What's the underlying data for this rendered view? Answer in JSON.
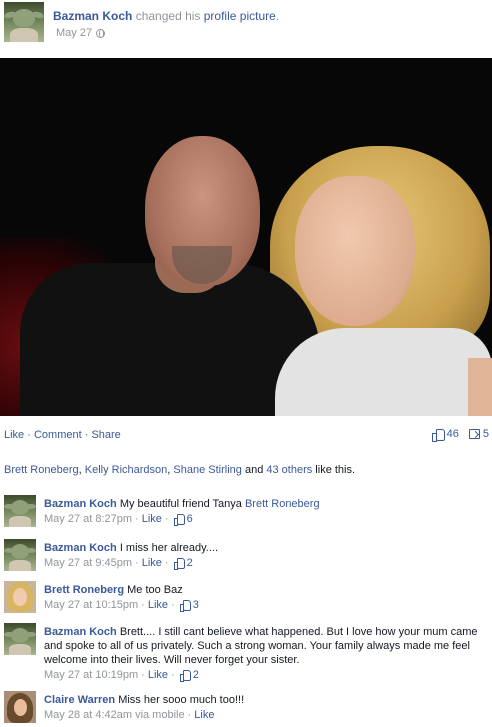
{
  "post": {
    "author": "Bazman Koch",
    "action_pre": " changed his ",
    "action_link": "profile picture",
    "action_post": ".",
    "date": "May 27"
  },
  "actions": {
    "like": "Like",
    "comment": "Comment",
    "share": "Share",
    "sep": " · ",
    "like_count": "46",
    "share_count": "5"
  },
  "likes": {
    "names": [
      "Brett Roneberg",
      "Kelly Richardson",
      "Shane Stirling"
    ],
    "sep1": ", ",
    "and": " and ",
    "others": "43 others",
    "suffix": " like this."
  },
  "comments": [
    {
      "name": "Bazman Koch",
      "text": "My beautiful friend Tanya ",
      "tag": "Brett Roneberg",
      "time": "May 27 at 8:27pm",
      "via": "",
      "like": "Like",
      "likes": "6"
    },
    {
      "name": "Bazman Koch",
      "text": "I miss her already....",
      "tag": "",
      "time": "May 27 at 9:45pm",
      "via": "",
      "like": "Like",
      "likes": "2"
    },
    {
      "name": "Brett Roneberg",
      "text": "Me too Baz",
      "tag": "",
      "time": "May 27 at 10:15pm",
      "via": "",
      "like": "Like",
      "likes": "3"
    },
    {
      "name": "Bazman Koch",
      "text": "Brett.... I still cant believe what happened. But I love how your mum came and spoke to all of us privately. Such a strong woman. Your family always made me feel welcome into their lives. Will never forget your sister.",
      "tag": "",
      "time": "May 27 at 10:19pm",
      "via": "",
      "like": "Like",
      "likes": "2"
    },
    {
      "name": "Claire Warren",
      "text": "Miss her sooo much too!!!",
      "tag": "",
      "time": "May 28 at 4:42am",
      "via": " via mobile",
      "like": "Like",
      "likes": ""
    }
  ],
  "colors": {
    "link": "#3b5998",
    "meta": "#90949c",
    "text": "#141823"
  }
}
